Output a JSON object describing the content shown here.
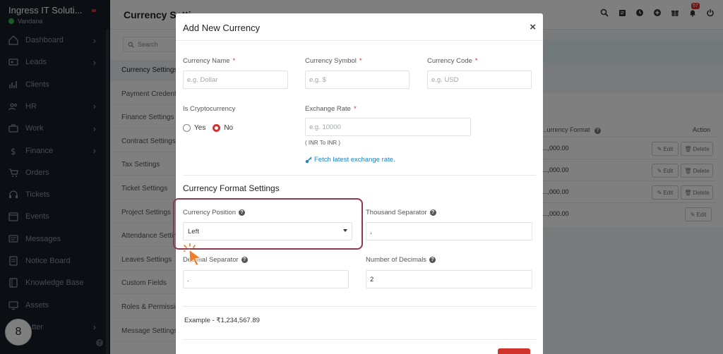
{
  "app": {
    "brand_name": "Ingress IT Soluti...",
    "user_name": "Vandana"
  },
  "sidebar": {
    "items": [
      {
        "label": "Dashboard",
        "icon": "home-icon",
        "has_chevron": true
      },
      {
        "label": "Leads",
        "icon": "id-card-icon",
        "has_chevron": true
      },
      {
        "label": "Clients",
        "icon": "chart-icon",
        "has_chevron": false
      },
      {
        "label": "HR",
        "icon": "users-icon",
        "has_chevron": true
      },
      {
        "label": "Work",
        "icon": "briefcase-icon",
        "has_chevron": true
      },
      {
        "label": "Finance",
        "icon": "dollar-icon",
        "has_chevron": true
      },
      {
        "label": "Orders",
        "icon": "cart-icon",
        "has_chevron": false
      },
      {
        "label": "Tickets",
        "icon": "headset-icon",
        "has_chevron": false
      },
      {
        "label": "Events",
        "icon": "calendar-icon",
        "has_chevron": false
      },
      {
        "label": "Messages",
        "icon": "message-icon",
        "has_chevron": false
      },
      {
        "label": "Notice Board",
        "icon": "notice-icon",
        "has_chevron": false
      },
      {
        "label": "Knowledge Base",
        "icon": "book-icon",
        "has_chevron": false
      },
      {
        "label": "Assets",
        "icon": "monitor-icon",
        "has_chevron": false
      },
      {
        "label": "...tter",
        "icon": "letter-icon",
        "has_chevron": true
      }
    ],
    "step_badge": "8"
  },
  "topbar": {
    "page_title": "Currency Setti...",
    "notification_count": "57"
  },
  "settings_menu": {
    "search_placeholder": "Search",
    "items": [
      {
        "label": "Currency Settings",
        "active": true
      },
      {
        "label": "Payment Credentials",
        "active": false
      },
      {
        "label": "Finance Settings",
        "active": false
      },
      {
        "label": "Contract Settings",
        "active": false
      },
      {
        "label": "Tax Settings",
        "active": false
      },
      {
        "label": "Ticket Settings",
        "active": false
      },
      {
        "label": "Project Settings",
        "active": false
      },
      {
        "label": "Attendance Settings",
        "active": false
      },
      {
        "label": "Leaves Settings",
        "active": false
      },
      {
        "label": "Custom Fields",
        "active": false
      },
      {
        "label": "Roles & Permissions",
        "active": false
      },
      {
        "label": "Message Settings",
        "active": false
      }
    ]
  },
  "background_table": {
    "header_format": "...urrency Format",
    "header_action": "Action",
    "rows": [
      {
        "amount": "...,000.00",
        "edit": "Edit",
        "delete": "Delete"
      },
      {
        "amount": "...,000.00",
        "edit": "Edit",
        "delete": "Delete"
      },
      {
        "amount": "...,000.00",
        "edit": "Edit",
        "delete": "Delete"
      },
      {
        "amount": "...,000.00",
        "edit": "Edit",
        "delete": ""
      }
    ]
  },
  "modal": {
    "title": "Add New Currency",
    "close": "×",
    "fields": {
      "currency_name": {
        "label": "Currency Name",
        "placeholder": "e.g. Dollar",
        "value": ""
      },
      "currency_symbol": {
        "label": "Currency Symbol",
        "placeholder": "e.g. $",
        "value": ""
      },
      "currency_code": {
        "label": "Currency Code",
        "placeholder": "e.g. USD",
        "value": ""
      },
      "is_crypto": {
        "label": "Is Cryptocurrency",
        "options": [
          "Yes",
          "No"
        ],
        "selected": "No"
      },
      "exchange_rate": {
        "label": "Exchange Rate",
        "placeholder": "e.g. 10000",
        "value": "",
        "hint": "( INR To INR )",
        "fetch_link": "Fetch latest exchange rate."
      }
    },
    "format_section": {
      "title": "Currency Format Settings",
      "currency_position": {
        "label": "Currency Position",
        "value": "Left"
      },
      "thousand_separator": {
        "label": "Thousand Separator",
        "value": ","
      },
      "decimal_separator": {
        "label": "Decimal Separator",
        "value": "."
      },
      "number_of_decimals": {
        "label": "Number of Decimals",
        "value": "2"
      },
      "example": "Example - ₹1,234,567.89"
    }
  },
  "colors": {
    "accent_red": "#d0342c",
    "sidebar_bg": "#171f29",
    "link_blue": "#1d82c6",
    "highlight_outline": "#8a3a4a"
  }
}
